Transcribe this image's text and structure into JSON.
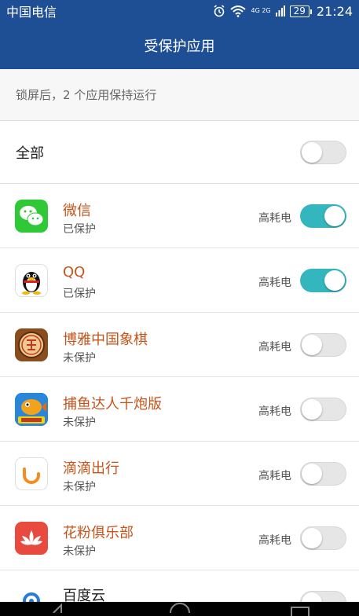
{
  "status_bar": {
    "carrier": "中国电信",
    "network": "4G 2G",
    "battery": "29",
    "time": "21:24"
  },
  "title": "受保护应用",
  "subtitle": "锁屏后，2 个应用保持运行",
  "all_row": {
    "label": "全部",
    "toggle_on": false
  },
  "power_label": "高耗电",
  "apps": [
    {
      "name": "微信",
      "status": "已保护",
      "power": "高耗电",
      "toggle_on": true,
      "icon": "wechat-icon"
    },
    {
      "name": "QQ",
      "status": "已保护",
      "power": "高耗电",
      "toggle_on": true,
      "icon": "qq-penguin-icon"
    },
    {
      "name": "博雅中国象棋",
      "status": "未保护",
      "power": "高耗电",
      "toggle_on": false,
      "icon": "chinese-chess-icon"
    },
    {
      "name": "捕鱼达人千炮版",
      "status": "未保护",
      "power": "高耗电",
      "toggle_on": false,
      "icon": "fishing-game-icon"
    },
    {
      "name": "滴滴出行",
      "status": "未保护",
      "power": "高耗电",
      "toggle_on": false,
      "icon": "didi-icon"
    },
    {
      "name": "花粉俱乐部",
      "status": "未保护",
      "power": "高耗电",
      "toggle_on": false,
      "icon": "lotus-icon"
    },
    {
      "name": "百度云",
      "icon": "baidu-cloud-icon",
      "toggle_on": false
    }
  ],
  "colors": {
    "header": "#1e4f94",
    "accent_toggle": "#33b6bd",
    "app_name": "#c6541b"
  }
}
